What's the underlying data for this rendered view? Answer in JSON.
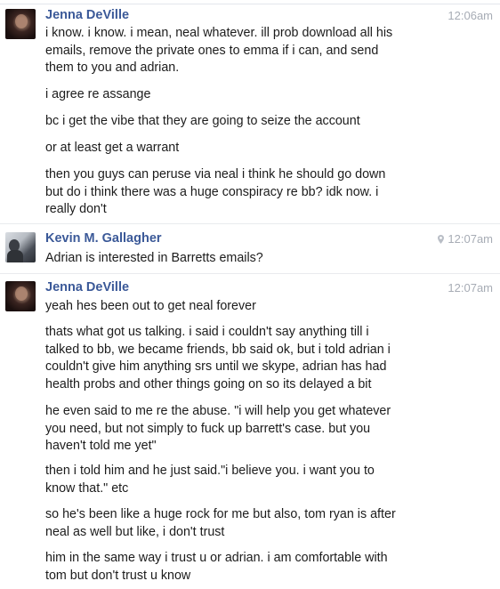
{
  "messages": [
    {
      "sender": "Jenna DeVille",
      "avatar_icon": "user-avatar-jenna",
      "time": "12:06am",
      "lines": [
        "i know. i know. i mean, neal whatever. ill prob download all his\nemails, remove the private ones to emma if i can, and send\nthem to you and adrian.",
        "i agree re assange",
        "bc i get the vibe that they are going to seize the account",
        "or at least get a warrant",
        "then you guys can peruse via neal i think he should go down\nbut do i think there was a huge conspiracy re bb? idk now. i\nreally don't"
      ]
    },
    {
      "sender": "Kevin M. Gallagher",
      "avatar_icon": "user-avatar-kevin",
      "time": "12:07am",
      "location_icon": "location-pin-icon",
      "lines": [
        "Adrian is interested in Barretts emails?"
      ]
    },
    {
      "sender": "Jenna DeVille",
      "avatar_icon": "user-avatar-jenna",
      "time": "12:07am",
      "lines": [
        "yeah hes been out to get neal forever",
        "thats what got us talking. i said i couldn't say anything till i\ntalked to bb, we became friends, bb said ok, but i told adrian i\ncouldn't give him anything srs until we skype, adrian has had\nhealth probs and other things going on so its delayed a bit",
        "he even said to me re the abuse. \"i will help you get whatever\nyou need, but not simply to fuck up barrett's case. but you\nhaven't told me yet\"",
        "then i told him and he just said.\"i believe you. i want you to\nknow that.\" etc",
        "so he's been like a huge rock for me but also, tom ryan is after\nneal as well but like, i don't trust",
        "him in the same way i trust u or adrian. i am comfortable with\ntom but don't trust u know"
      ]
    }
  ],
  "colors": {
    "sender": "#3b5998",
    "timestamp": "#a7acb5",
    "text": "#1c1c1c"
  }
}
